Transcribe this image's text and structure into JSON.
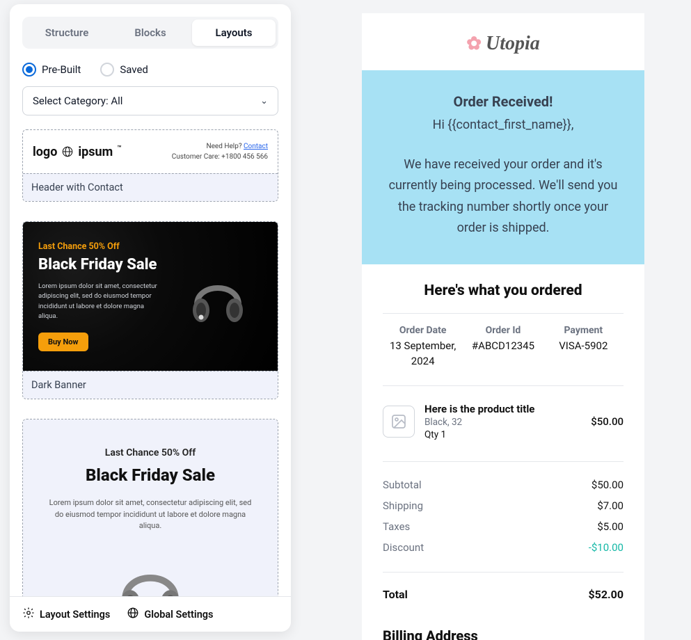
{
  "tabs": {
    "structure": "Structure",
    "blocks": "Blocks",
    "layouts": "Layouts"
  },
  "radios": {
    "prebuilt": "Pre-Built",
    "saved": "Saved"
  },
  "select_category": "Select Category: All",
  "card1": {
    "label": "Header with Contact",
    "logo_a": "logo",
    "logo_b": "ipsum",
    "need_help": "Need Help? ",
    "contact": "Contact",
    "care": "Customer Care: +1800 456 566"
  },
  "card2": {
    "label": "Dark Banner",
    "tag": "Last Chance 50% Off",
    "title": "Black Friday Sale",
    "lorem": "Lorem ipsum dolor sit amet, consectetur adipiscing elit, sed do eiusmod tempor incididunt ut labore et dolore magna aliqua.",
    "btn": "Buy Now"
  },
  "card3": {
    "tag": "Last Chance 50% Off",
    "title": "Black Friday Sale",
    "lorem": "Lorem ipsum dolor sit amet, consectetur adipiscing elit, sed do eiusmod tempor incididunt ut labore et dolore magna aliqua."
  },
  "bottom": {
    "layout": "Layout Settings",
    "global": "Global Settings"
  },
  "preview": {
    "brand": "Utopia",
    "hero_title": "Order Received!",
    "hero_hi": "Hi {{contact_first_name}},",
    "hero_body": "We have received your order and it's currently being processed. We'll send you the tracking number shortly once your order is shipped.",
    "ordered_h": "Here's what you ordered",
    "meta": {
      "date_l": "Order Date",
      "date_v": "13 September, 2024",
      "id_l": "Order Id",
      "id_v": "#ABCD12345",
      "pay_l": "Payment",
      "pay_v": "VISA-5902"
    },
    "item": {
      "title": "Here is the product title",
      "variant": "Black, 32",
      "qty": "Qty 1",
      "price": "$50.00"
    },
    "totals": {
      "subtotal_l": "Subtotal",
      "subtotal_v": "$50.00",
      "shipping_l": "Shipping",
      "shipping_v": "$7.00",
      "taxes_l": "Taxes",
      "taxes_v": "$5.00",
      "discount_l": "Discount",
      "discount_v": "-$10.00",
      "total_l": "Total",
      "total_v": "$52.00"
    },
    "billing_h": "Billing Address"
  }
}
